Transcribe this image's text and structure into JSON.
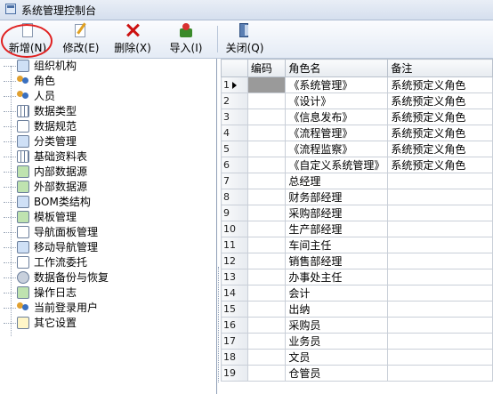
{
  "window": {
    "title": "系统管理控制台"
  },
  "toolbar": {
    "buttons": [
      {
        "label": "新增(N)",
        "icon": "new-document-icon"
      },
      {
        "label": "修改(E)",
        "icon": "edit-icon"
      },
      {
        "label": "删除(X)",
        "icon": "delete-icon"
      },
      {
        "label": "导入(I)",
        "icon": "import-icon"
      },
      {
        "label": "关闭(Q)",
        "icon": "close-door-icon"
      }
    ]
  },
  "tree": {
    "items": [
      {
        "label": "组织机构",
        "icon": "org-icon"
      },
      {
        "label": "角色",
        "icon": "role-icon"
      },
      {
        "label": "人员",
        "icon": "person-icon"
      },
      {
        "label": "数据类型",
        "icon": "data-type-icon"
      },
      {
        "label": "数据规范",
        "icon": "data-spec-icon"
      },
      {
        "label": "分类管理",
        "icon": "category-icon"
      },
      {
        "label": "基础资料表",
        "icon": "base-table-icon"
      },
      {
        "label": "内部数据源",
        "icon": "internal-source-icon"
      },
      {
        "label": "外部数据源",
        "icon": "external-source-icon"
      },
      {
        "label": "BOM类结构",
        "icon": "bom-icon"
      },
      {
        "label": "模板管理",
        "icon": "template-icon"
      },
      {
        "label": "导航面板管理",
        "icon": "nav-panel-icon"
      },
      {
        "label": "移动导航管理",
        "icon": "mobile-nav-icon"
      },
      {
        "label": "工作流委托",
        "icon": "workflow-icon"
      },
      {
        "label": "数据备份与恢复",
        "icon": "backup-icon"
      },
      {
        "label": "操作日志",
        "icon": "log-icon"
      },
      {
        "label": "当前登录用户",
        "icon": "users-icon"
      },
      {
        "label": "其它设置",
        "icon": "settings-icon"
      }
    ]
  },
  "grid": {
    "columns": [
      "编码",
      "角色名",
      "备注"
    ],
    "rows": [
      {
        "num": "1",
        "code": "",
        "name": "《系统管理》",
        "note": "系统预定义角色"
      },
      {
        "num": "2",
        "code": "",
        "name": "《设计》",
        "note": "系统预定义角色"
      },
      {
        "num": "3",
        "code": "",
        "name": "《信息发布》",
        "note": "系统预定义角色"
      },
      {
        "num": "4",
        "code": "",
        "name": "《流程管理》",
        "note": "系统预定义角色"
      },
      {
        "num": "5",
        "code": "",
        "name": "《流程监察》",
        "note": "系统预定义角色"
      },
      {
        "num": "6",
        "code": "",
        "name": "《自定义系统管理》",
        "note": "系统预定义角色"
      },
      {
        "num": "7",
        "code": "",
        "name": "总经理",
        "note": ""
      },
      {
        "num": "8",
        "code": "",
        "name": "财务部经理",
        "note": ""
      },
      {
        "num": "9",
        "code": "",
        "name": "采购部经理",
        "note": ""
      },
      {
        "num": "10",
        "code": "",
        "name": "生产部经理",
        "note": ""
      },
      {
        "num": "11",
        "code": "",
        "name": "车间主任",
        "note": ""
      },
      {
        "num": "12",
        "code": "",
        "name": "销售部经理",
        "note": ""
      },
      {
        "num": "13",
        "code": "",
        "name": "办事处主任",
        "note": ""
      },
      {
        "num": "14",
        "code": "",
        "name": "会计",
        "note": ""
      },
      {
        "num": "15",
        "code": "",
        "name": "出纳",
        "note": ""
      },
      {
        "num": "16",
        "code": "",
        "name": "采购员",
        "note": ""
      },
      {
        "num": "17",
        "code": "",
        "name": "业务员",
        "note": ""
      },
      {
        "num": "18",
        "code": "",
        "name": "文员",
        "note": ""
      },
      {
        "num": "19",
        "code": "",
        "name": "仓管员",
        "note": ""
      }
    ]
  },
  "colors": {
    "highlight_oval": "#e02020",
    "selected_cell": "#9a9a9a"
  }
}
